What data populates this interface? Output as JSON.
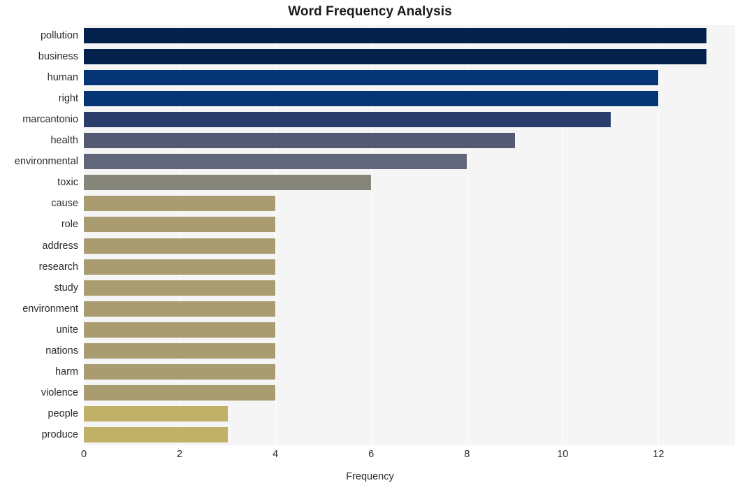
{
  "chart_data": {
    "type": "bar",
    "orientation": "horizontal",
    "title": "Word Frequency Analysis",
    "xlabel": "Frequency",
    "ylabel": "",
    "xlim": [
      0,
      13.6
    ],
    "xticks": [
      0,
      2,
      4,
      6,
      8,
      10,
      12
    ],
    "xticklabels": [
      "0",
      "2",
      "4",
      "6",
      "8",
      "10",
      "12"
    ],
    "grid": "vertical",
    "legend": "none",
    "categories": [
      "pollution",
      "business",
      "human",
      "right",
      "marcantonio",
      "health",
      "environmental",
      "toxic",
      "cause",
      "role",
      "address",
      "research",
      "study",
      "environment",
      "unite",
      "nations",
      "harm",
      "violence",
      "people",
      "produce"
    ],
    "values": [
      13,
      13,
      12,
      12,
      11,
      9,
      8,
      6,
      4,
      4,
      4,
      4,
      4,
      4,
      4,
      4,
      4,
      4,
      3,
      3
    ],
    "bar_colors": [
      "#04214b",
      "#04214b",
      "#053575",
      "#053575",
      "#2a3d6b",
      "#535a72",
      "#62667a",
      "#86857a",
      "#a89c70",
      "#a89c70",
      "#a89c70",
      "#a89c70",
      "#a89c70",
      "#a89c70",
      "#a89c70",
      "#a89c70",
      "#a89c70",
      "#a89c70",
      "#c0b068",
      "#c0b068"
    ],
    "plot_background": "#f5f5f6",
    "figure_background": "#ffffff",
    "gridline_color": "#ffffff"
  }
}
